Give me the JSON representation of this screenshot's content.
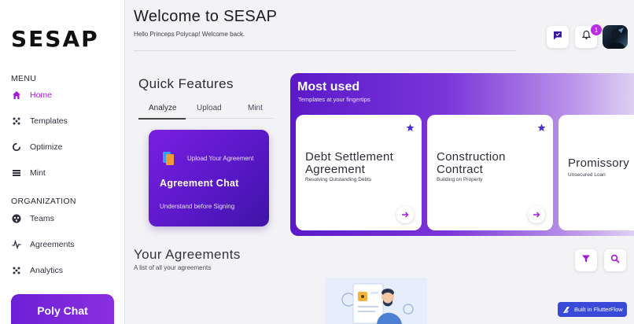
{
  "app": {
    "logo": "SESAP"
  },
  "sidebar": {
    "menu_label": "MENU",
    "menu_items": [
      {
        "label": "Home",
        "icon": "home-icon",
        "active": true
      },
      {
        "label": "Templates",
        "icon": "templates-icon"
      },
      {
        "label": "Optimize",
        "icon": "optimize-icon"
      },
      {
        "label": "Mint",
        "icon": "mint-icon"
      }
    ],
    "org_label": "ORGANIZATION",
    "org_items": [
      {
        "label": "Teams",
        "icon": "teams-icon"
      },
      {
        "label": "Agreements",
        "icon": "agreements-icon"
      },
      {
        "label": "Analytics",
        "icon": "analytics-icon"
      }
    ],
    "poly_chat": "Poly Chat"
  },
  "header": {
    "title": "Welcome to SESAP",
    "subtitle": "Hello Princeps Polycap!  Welcome back.",
    "notification_count": "1"
  },
  "quick_features": {
    "title": "Quick Features",
    "tabs": [
      "Analyze",
      "Upload",
      "Mint"
    ],
    "active_tab": "Analyze",
    "card": {
      "upload_label": "Upload Your Agreement",
      "title": "Agreement Chat",
      "subtitle": "Understand before Signing"
    }
  },
  "most_used": {
    "title": "Most used",
    "subtitle": "Templates at your fingertips",
    "templates": [
      {
        "title_line1": "Debt Settlement",
        "title_line2": "Agreement",
        "subtitle": "Resolving Outstanding Debts"
      },
      {
        "title_line1": "Construction",
        "title_line2": "Contract",
        "subtitle": "Building on Property"
      },
      {
        "title_line1": "Promissory",
        "title_line2": "",
        "subtitle": "Unsecured Loan"
      }
    ]
  },
  "your_agreements": {
    "title": "Your Agreements",
    "subtitle": "A list of all your agreements"
  },
  "flutterflow_badge": "Built in FlutterFlow",
  "colors": {
    "accent": "#a31ad4",
    "primary_purple": "#5b19c9",
    "star": "#4b2fd1"
  }
}
